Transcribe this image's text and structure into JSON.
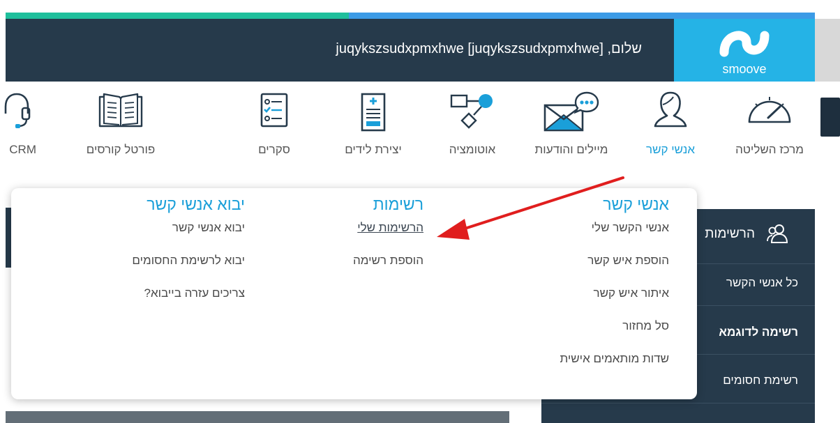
{
  "header": {
    "greeting": "שלום, juqykszsudxpmxhwe [juqykszsudxpmxhwe]",
    "brand": "smoove"
  },
  "nav": [
    {
      "label": "מרכז השליטה",
      "icon": "gauge-icon"
    },
    {
      "label": "אנשי קשר",
      "icon": "person-icon",
      "active": true
    },
    {
      "label": "מיילים והודעות",
      "icon": "mail-chat-icon"
    },
    {
      "label": "אוטומציה",
      "icon": "flowchart-icon"
    },
    {
      "label": "יצירת לידים",
      "icon": "form-icon"
    },
    {
      "label": "סקרים",
      "icon": "checklist-icon"
    },
    {
      "label": "פורטל קורסים",
      "icon": "book-icon"
    },
    {
      "label": "CRM",
      "icon": "headset-icon"
    }
  ],
  "dropdown": {
    "contacts": {
      "title": "אנשי קשר",
      "items": [
        "אנשי הקשר שלי",
        "הוספת איש קשר",
        "איתור איש קשר",
        "סל מחזור",
        "שדות מותאמים אישית"
      ]
    },
    "lists": {
      "title": "רשימות",
      "items": [
        "הרשימות שלי",
        "הוספת רשימה"
      ]
    },
    "import": {
      "title": "יבוא אנשי קשר",
      "items": [
        "יבוא אנשי קשר",
        "יבוא לרשימת החסומים",
        "צריכים עזרה בייבוא?"
      ]
    }
  },
  "sidebar": {
    "title": "הרשימות",
    "items": [
      "כל אנשי הקשר",
      "רשימה לדוגמא",
      "רשימת חסומים"
    ]
  },
  "colors": {
    "header": "#263a4b",
    "logo": "#25b3e6",
    "accent": "#1a9fd9",
    "arrow": "#e01e1e"
  }
}
